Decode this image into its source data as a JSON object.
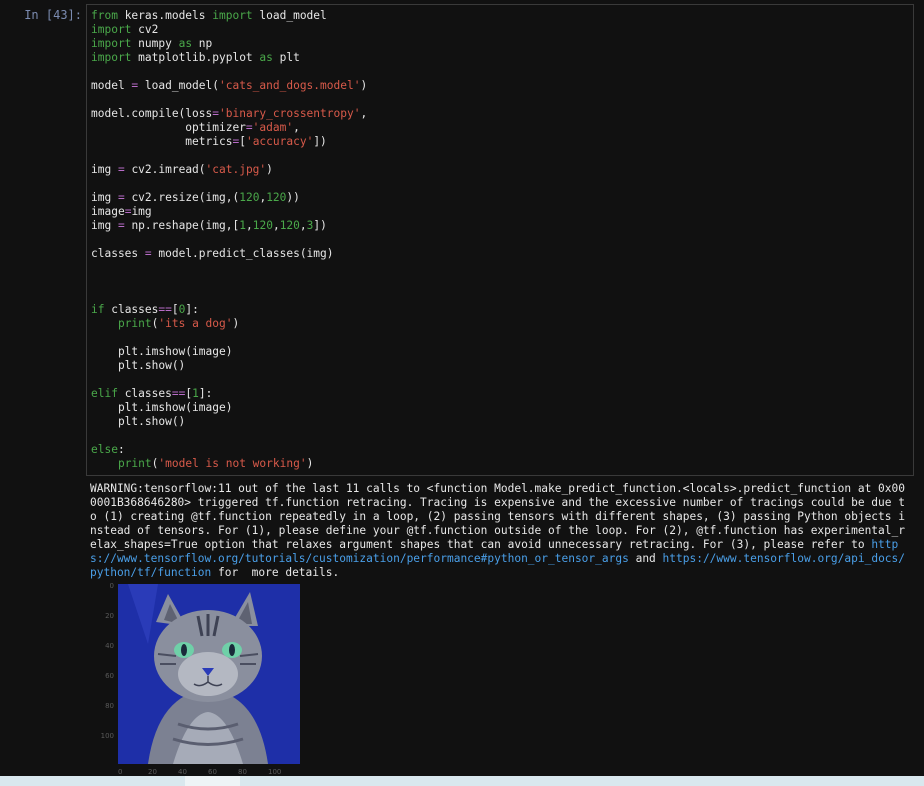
{
  "cell": {
    "prompt": "In [43]:",
    "code_lines": [
      [
        [
          "kw",
          "from"
        ],
        [
          "t",
          " keras.models "
        ],
        [
          "kw",
          "import"
        ],
        [
          "t",
          " load_model"
        ]
      ],
      [
        [
          "kw",
          "import"
        ],
        [
          "t",
          " cv2"
        ]
      ],
      [
        [
          "kw",
          "import"
        ],
        [
          "t",
          " numpy "
        ],
        [
          "kw",
          "as"
        ],
        [
          "t",
          " np"
        ]
      ],
      [
        [
          "kw",
          "import"
        ],
        [
          "t",
          " matplotlib.pyplot "
        ],
        [
          "kw",
          "as"
        ],
        [
          "t",
          " plt"
        ]
      ],
      [],
      [
        [
          "t",
          "model "
        ],
        [
          "op",
          "="
        ],
        [
          "t",
          " load_model("
        ],
        [
          "str",
          "'cats_and_dogs.model'"
        ],
        [
          "t",
          ")"
        ]
      ],
      [],
      [
        [
          "t",
          "model.compile(loss"
        ],
        [
          "op",
          "="
        ],
        [
          "str",
          "'binary_crossentropy'"
        ],
        [
          "t",
          ","
        ]
      ],
      [
        [
          "t",
          "              optimizer"
        ],
        [
          "op",
          "="
        ],
        [
          "str",
          "'adam'"
        ],
        [
          "t",
          ","
        ]
      ],
      [
        [
          "t",
          "              metrics"
        ],
        [
          "op",
          "="
        ],
        [
          "t",
          "["
        ],
        [
          "str",
          "'accuracy'"
        ],
        [
          "t",
          "])"
        ]
      ],
      [],
      [
        [
          "t",
          "img "
        ],
        [
          "op",
          "="
        ],
        [
          "t",
          " cv2.imread("
        ],
        [
          "str",
          "'cat.jpg'"
        ],
        [
          "t",
          ")"
        ]
      ],
      [],
      [
        [
          "t",
          "img "
        ],
        [
          "op",
          "="
        ],
        [
          "t",
          " cv2.resize(img,("
        ],
        [
          "num",
          "120"
        ],
        [
          "t",
          ","
        ],
        [
          "num",
          "120"
        ],
        [
          "t",
          "))"
        ]
      ],
      [
        [
          "t",
          "image"
        ],
        [
          "op",
          "="
        ],
        [
          "t",
          "img"
        ]
      ],
      [
        [
          "t",
          "img "
        ],
        [
          "op",
          "="
        ],
        [
          "t",
          " np.reshape(img,["
        ],
        [
          "num",
          "1"
        ],
        [
          "t",
          ","
        ],
        [
          "num",
          "120"
        ],
        [
          "t",
          ","
        ],
        [
          "num",
          "120"
        ],
        [
          "t",
          ","
        ],
        [
          "num",
          "3"
        ],
        [
          "t",
          "])"
        ]
      ],
      [],
      [
        [
          "t",
          "classes "
        ],
        [
          "op",
          "="
        ],
        [
          "t",
          " model.predict_classes(img)"
        ]
      ],
      [],
      [],
      [],
      [
        [
          "kw",
          "if"
        ],
        [
          "t",
          " classes"
        ],
        [
          "op",
          "=="
        ],
        [
          "t",
          "["
        ],
        [
          "num",
          "0"
        ],
        [
          "t",
          "]:"
        ]
      ],
      [
        [
          "t",
          "    "
        ],
        [
          "kw",
          "print"
        ],
        [
          "t",
          "("
        ],
        [
          "str",
          "'its a dog'"
        ],
        [
          "t",
          ")"
        ]
      ],
      [],
      [
        [
          "t",
          "    plt.imshow(image)"
        ]
      ],
      [
        [
          "t",
          "    plt.show()"
        ]
      ],
      [],
      [
        [
          "kw",
          "elif"
        ],
        [
          "t",
          " classes"
        ],
        [
          "op",
          "=="
        ],
        [
          "t",
          "["
        ],
        [
          "num",
          "1"
        ],
        [
          "t",
          "]:"
        ]
      ],
      [
        [
          "t",
          "    plt.imshow(image)"
        ]
      ],
      [
        [
          "t",
          "    plt.show()"
        ]
      ],
      [],
      [
        [
          "kw",
          "else"
        ],
        [
          "t",
          ":"
        ]
      ],
      [
        [
          "t",
          "    "
        ],
        [
          "kw",
          "print"
        ],
        [
          "t",
          "("
        ],
        [
          "str",
          "'model is not working'"
        ],
        [
          "t",
          ")"
        ]
      ]
    ]
  },
  "output": {
    "warning_text": "WARNING:tensorflow:11 out of the last 11 calls to <function Model.make_predict_function.<locals>.predict_function at 0x000001B368646280> triggered tf.function retracing. Tracing is expensive and the excessive number of tracings could be due to (1) creating @tf.function repeatedly in a loop, (2) passing tensors with different shapes, (3) passing Python objects instead of tensors. For (1), please define your @tf.function outside of the loop. For (2), @tf.function has experimental_relax_shapes=True option that relaxes argument shapes that can avoid unnecessary retracing. For (3), please refer to ",
    "link1": "https://www.tensorflow.org/tutorials/customization/performance#python_or_tensor_args",
    "and_text": " and ",
    "link2": "https://www.tensorflow.org/api_docs/python/tf/function",
    "tail_text": " for  more details."
  },
  "plot": {
    "image_subject": "cat photo (blue-tinted)",
    "y_ticks": [
      "0",
      "20",
      "40",
      "60",
      "80",
      "100"
    ],
    "x_ticks": [
      "0",
      "20",
      "40",
      "60",
      "80",
      "100"
    ],
    "colors": {
      "background": "#1e2fa8",
      "fur": "#8a8f9e"
    }
  }
}
